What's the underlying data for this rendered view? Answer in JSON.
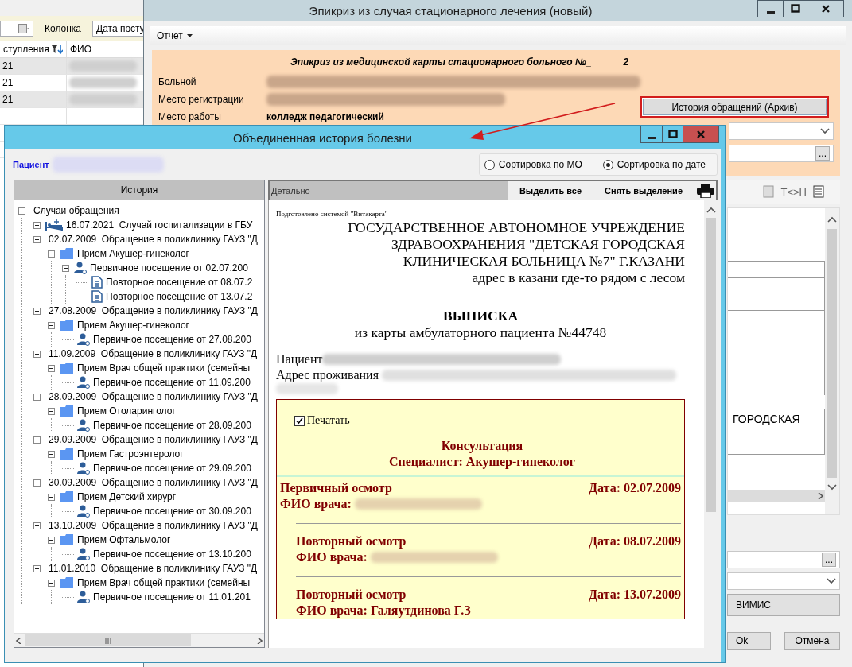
{
  "background_app": {
    "column_label": "Колонка",
    "column_value": "Дата посту",
    "grid_columns": [
      "ступления",
      "ФИО"
    ],
    "rows": [
      {
        "date": "21",
        "fio_hidden": true
      },
      {
        "date": "21",
        "fio_hidden": true
      },
      {
        "date": "21",
        "fio_hidden": true
      }
    ]
  },
  "epicrisis_window": {
    "title": "Эпикриз из случая стационарного лечения (новый)",
    "menu": "Отчет",
    "heading": "Эпикриз из медицинской карты стационарного больного №_",
    "number": "2",
    "fields": [
      {
        "label": "Больной",
        "value_hidden": true
      },
      {
        "label": "Место регистрации",
        "value_hidden": true
      },
      {
        "label": "Место работы",
        "value": "колледж педагогический",
        "value_hidden": false
      }
    ],
    "archive_button": "История обращений (Архив)",
    "browse_buttons": [
      "...",
      "..."
    ],
    "toolbar_text": "T<>H",
    "preview_text": "ГОРОДСКАЯ",
    "vimis_button": "ВИМИС",
    "ok_button": "Ok",
    "cancel_button": "Отмена"
  },
  "history_window": {
    "title": "Объединенная история болезни",
    "patient_label": "Пациент",
    "patient_hidden": true,
    "sort_options": [
      {
        "label": "Сортировка по МО",
        "selected": false
      },
      {
        "label": "Сортировка по дате",
        "selected": true
      }
    ],
    "history_header": "История",
    "detail_header": "Детально",
    "detail_buttons": [
      "Выделить все",
      "Снять выделение"
    ],
    "tree": {
      "kind": "root",
      "label": "Случаи обращения",
      "expanded": true,
      "children": [
        {
          "kind": "hospital",
          "label": "16.07.2021  Случай госпитализации в ГБУ",
          "expanded": false
        },
        {
          "kind": "case",
          "label": "02.07.2009  Обращение в поликлинику ГАУЗ \"Д",
          "expanded": true,
          "children": [
            {
              "kind": "folder",
              "label": "Прием Акушер-гинеколог",
              "expanded": true,
              "children": [
                {
                  "kind": "person",
                  "label": "Первичное посещение от 02.07.200",
                  "expanded": true,
                  "children": [
                    {
                      "kind": "document",
                      "label": "Повторное посещение от 08.07.2"
                    },
                    {
                      "kind": "document",
                      "label": "Повторное посещение от 13.07.2"
                    }
                  ]
                }
              ]
            }
          ]
        },
        {
          "kind": "case",
          "label": "27.08.2009  Обращение в поликлинику ГАУЗ \"Д",
          "expanded": true,
          "children": [
            {
              "kind": "folder",
              "label": "Прием Акушер-гинеколог",
              "expanded": true,
              "children": [
                {
                  "kind": "person",
                  "label": "Первичное посещение от 27.08.200"
                }
              ]
            }
          ]
        },
        {
          "kind": "case",
          "label": "11.09.2009  Обращение в поликлинику ГАУЗ \"Д",
          "expanded": true,
          "children": [
            {
              "kind": "folder",
              "label": "Прием Врач общей практики (семейны",
              "expanded": true,
              "children": [
                {
                  "kind": "person",
                  "label": "Первичное посещение от 11.09.200"
                }
              ]
            }
          ]
        },
        {
          "kind": "case",
          "label": "28.09.2009  Обращение в поликлинику ГАУЗ \"Д",
          "expanded": true,
          "children": [
            {
              "kind": "folder",
              "label": "Прием Отоларинголог",
              "expanded": true,
              "children": [
                {
                  "kind": "person",
                  "label": "Первичное посещение от 28.09.200"
                }
              ]
            }
          ]
        },
        {
          "kind": "case",
          "label": "29.09.2009  Обращение в поликлинику ГАУЗ \"Д",
          "expanded": true,
          "children": [
            {
              "kind": "folder",
              "label": "Прием Гастроэнтеролог",
              "expanded": true,
              "children": [
                {
                  "kind": "person",
                  "label": "Первичное посещение от 29.09.200"
                }
              ]
            }
          ]
        },
        {
          "kind": "case",
          "label": "30.09.2009  Обращение в поликлинику ГАУЗ \"Д",
          "expanded": true,
          "children": [
            {
              "kind": "folder",
              "label": "Прием Детский хирург",
              "expanded": true,
              "children": [
                {
                  "kind": "person",
                  "label": "Первичное посещение от 30.09.200"
                }
              ]
            }
          ]
        },
        {
          "kind": "case",
          "label": "13.10.2009  Обращение в поликлинику ГАУЗ \"Д",
          "expanded": true,
          "children": [
            {
              "kind": "folder",
              "label": "Прием Офтальмолог",
              "expanded": true,
              "children": [
                {
                  "kind": "person",
                  "label": "Первичное посещение от 13.10.200"
                }
              ]
            }
          ]
        },
        {
          "kind": "case",
          "label": "11.01.2010  Обращение в поликлинику ГАУЗ \"Д",
          "expanded": true,
          "children": [
            {
              "kind": "folder",
              "label": "Прием Врач общей практики (семейны",
              "expanded": true,
              "children": [
                {
                  "kind": "person",
                  "label": "Первичное посещение от 11.01.201"
                }
              ]
            }
          ]
        }
      ]
    },
    "document": {
      "prepared_by": "Подготовлено системой \"Витакарта\"",
      "org_lines": [
        "ГОСУДАРСТВЕННОЕ АВТОНОМНОЕ УЧРЕЖДЕНИЕ",
        "ЗДРАВООХРАНЕНИЯ \"ДЕТСКАЯ ГОРОДСКАЯ",
        "КЛИНИЧЕСКАЯ БОЛЬНИЦА №7\" Г.КАЗАНИ",
        "адрес в казани где-то рядом с лесом"
      ],
      "doc_title": "ВЫПИСКА",
      "doc_subtitle": "из карты амбулаторного пациента №44748",
      "patient_label": "Пациент",
      "address_label": "Адрес проживания",
      "section": {
        "print_label": "Печатать",
        "print_checked": true,
        "title": "Консультация",
        "specialist": "Специалист: Акушер-гинеколог",
        "visits": [
          {
            "kind": "primary",
            "title": "Первичный осмотр",
            "date": "Дата: 02.07.2009",
            "doctor_label": "ФИО врача:",
            "doctor_hidden": true
          },
          {
            "kind": "repeat",
            "title": "Повторный осмотр",
            "date": "Дата: 08.07.2009",
            "doctor_label": "ФИО врача:",
            "doctor_hidden": true
          },
          {
            "kind": "repeat",
            "title": "Повторный осмотр",
            "date": "Дата: 13.07.2009",
            "doctor_label": "ФИО врача: Галяутдинова Г.З",
            "doctor_hidden": false
          }
        ]
      }
    }
  }
}
